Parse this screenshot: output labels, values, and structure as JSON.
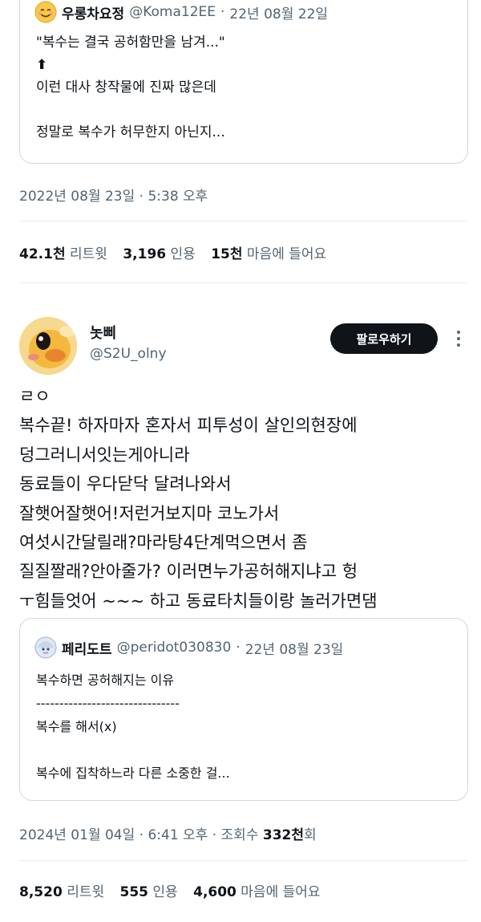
{
  "top_quote": {
    "name": "우롱차요정",
    "handle": "@Koma12EE",
    "dot": "·",
    "date": "22년 08월 22일",
    "lines": [
      "\"복수는 결국 공허함만을 남겨...\"",
      "⬆",
      "이런 대사 창작물에 진짜 많은데",
      "",
      "정말로 복수가 허무한지 아닌지..."
    ]
  },
  "first_tweet": {
    "timestamp": "2022년 08월 23일 · 5:38 오후",
    "stats": {
      "retweets_count": "42.1천",
      "retweets_label": "리트윗",
      "quotes_count": "3,196",
      "quotes_label": "인용",
      "likes_count": "15천",
      "likes_label": "마음에 들어요"
    }
  },
  "reply_tweet": {
    "display_name": "놋삐",
    "handle": "@S2U_olny",
    "follow_label": "팔로우하기",
    "lines": [
      "ㄹㅇ",
      "복수끝! 하자마자 혼자서 피투성이 살인의현장에",
      "덩그러니서잇는게아니라",
      "동료들이 우다닫닥 달려나와서",
      "잘햇어잘햇어!저런거보지마 코노가서",
      "여섯시간달릴래?마라탕4단계먹으면서 좀",
      "질질짤래?안아줄가? 이러면누가공허해지냐고 헝",
      "ㅜ힘들엇어 ~~~ 하고 동료타치들이랑 놀러가면댐"
    ],
    "quote": {
      "name": "페리도트",
      "handle": "@peridot030830",
      "dot": "·",
      "date": "22년 08월 23일",
      "lines": [
        "복수하면 공허해지는 이유",
        "-------------------------------",
        "복수를 해서(x)",
        "",
        "복수에 집착하느라 다른 소중한 걸..."
      ]
    },
    "timestamp": "2024년 01월 04일 · 6:41 오후 · 조회수",
    "views_count": "332천",
    "views_unit": "회",
    "stats": {
      "retweets_count": "8,520",
      "retweets_label": "리트윗",
      "quotes_count": "555",
      "quotes_label": "인용",
      "likes_count": "4,600",
      "likes_label": "마음에 들어요"
    }
  },
  "colors": {
    "text": "#0f1419",
    "muted": "#536471",
    "border": "#cfd9de",
    "button_bg": "#0f1419"
  }
}
